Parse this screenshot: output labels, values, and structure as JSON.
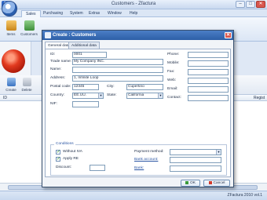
{
  "window": {
    "title": "Customers - Zfactura",
    "minimize": "–",
    "maximize": "□",
    "close": "✕",
    "logo": "Z"
  },
  "ribbon": {
    "tabs": [
      "Sales",
      "Purchasing",
      "System",
      "Extras",
      "Window",
      "Help"
    ],
    "buttons": [
      "Items",
      "Customers"
    ]
  },
  "toolbar": {
    "buttons": [
      "Create",
      "Delete"
    ]
  },
  "grid": {
    "first_col": "ID",
    "last_col": "Regist"
  },
  "status": {
    "version": "ZFactura 2010 vol.1"
  },
  "dialog": {
    "title": "Create : Customers",
    "close": "✕",
    "tabs": [
      "General data",
      "Additional data"
    ],
    "fields": {
      "id": {
        "label": "ID:",
        "value": "0001"
      },
      "trade_name": {
        "label": "Trade name:",
        "value": "My Company INC."
      },
      "name": {
        "label": "Name:",
        "value": ""
      },
      "address": {
        "label": "Address:",
        "value": "1, Infinite Loop"
      },
      "postal_code": {
        "label": "Postal code:",
        "value": "12345"
      },
      "city": {
        "label": "City:",
        "value": "Cupertino"
      },
      "country": {
        "label": "Country:",
        "value": "EE.UU."
      },
      "state": {
        "label": "State:",
        "value": "California"
      },
      "nif": {
        "label": "NIF:",
        "value": ""
      },
      "phone": {
        "label": "Phone:",
        "value": ""
      },
      "mobile": {
        "label": "Mobile:",
        "value": ""
      },
      "fax": {
        "label": "Fax:",
        "value": ""
      },
      "web": {
        "label": "Web:",
        "value": ""
      },
      "email": {
        "label": "Email:",
        "value": ""
      },
      "contact": {
        "label": "Contact:",
        "value": ""
      }
    },
    "conditions": {
      "title": "Conditions",
      "without_iva": {
        "label": "Without IVA",
        "checked": true
      },
      "apply_re": {
        "label": "Apply RE",
        "checked": true
      },
      "discount": {
        "label": "Discount:",
        "value": ""
      },
      "payment_method": {
        "label": "Payment method:",
        "value": ""
      },
      "bank_account": {
        "label": "Bank account:",
        "value": ""
      },
      "bank": {
        "label": "Bank:",
        "value": ""
      }
    },
    "ok_label": "OK",
    "cancel_label": "Cancel"
  },
  "colors": {
    "accent": "#2d5fa7",
    "link": "#2a55a3",
    "close": "#d9564d"
  },
  "icons": [
    "app-logo-icon",
    "app-orb-icon",
    "items-icon",
    "customers-icon",
    "create-icon",
    "delete-icon",
    "dialog-icon",
    "dropdown-arrow-icon",
    "ok-icon",
    "cancel-icon"
  ]
}
